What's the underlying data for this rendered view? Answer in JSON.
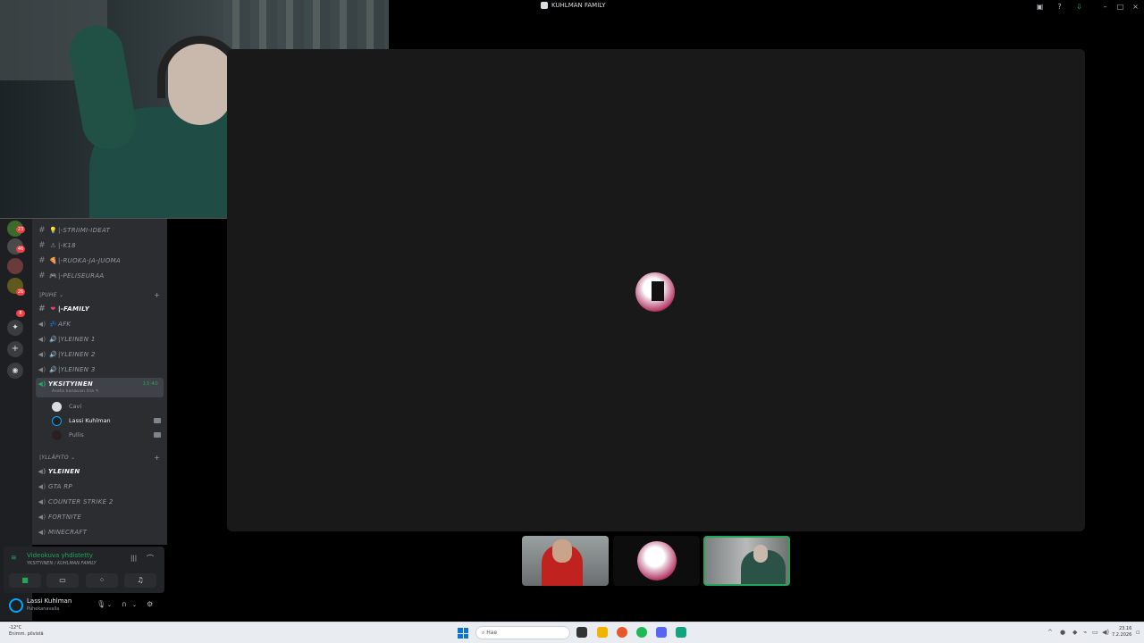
{
  "window": {
    "title": "KUHLMAN FAMILY"
  },
  "server_badges": [
    "23",
    "46",
    "26",
    "8"
  ],
  "sidebar": {
    "text_channels": [
      {
        "emoji": "💡",
        "name": "|-STRIIMI-IDEAT"
      },
      {
        "emoji": "⚠",
        "name": "|-K18"
      },
      {
        "emoji": "🍕",
        "name": "|-RUOKA-JA-JUOMA"
      },
      {
        "emoji": "🎮",
        "name": "|-PELISEURAA"
      }
    ],
    "category_puhe": "|PUHE ⌄",
    "voice_channels": [
      {
        "emoji": "❤",
        "name": "|-FAMILY",
        "bold": true,
        "type": "text"
      },
      {
        "emoji": "💤",
        "name": "AFK"
      },
      {
        "emoji": "🔊",
        "name": "|YLEINEN 1"
      },
      {
        "emoji": "🔊",
        "name": "|YLEINEN 2"
      },
      {
        "emoji": "🔊",
        "name": "|YLEINEN 3"
      }
    ],
    "active_channel": {
      "name": "YKSITYINEN",
      "time": "13:40",
      "subtitle": "Aseta kanavan tila ✎"
    },
    "members": [
      {
        "name": "Cavi",
        "camera": false
      },
      {
        "name": "Lassi Kuhlman",
        "camera": true
      },
      {
        "name": "Pullis",
        "camera": true
      }
    ],
    "category_yllapito": "|YLLÄPITO ⌄",
    "extra_channels": [
      {
        "name": "YLEINEN",
        "bold": true
      },
      {
        "name": "GTA RP"
      },
      {
        "name": "COUNTER STRIKE 2"
      },
      {
        "name": "FORTNITE"
      },
      {
        "name": "MINECRAFT"
      }
    ]
  },
  "voice_panel": {
    "status": "Videokuva yhdistetty",
    "channel": "YKSITYINEN / KUHLMAN FAMILY"
  },
  "user_panel": {
    "name": "Lassi Kuhlman",
    "status": "Puhekanavalla"
  },
  "taskbar": {
    "weather_temp": "-12°C",
    "weather_desc": "Enimm. pilvistä",
    "search_placeholder": "Hae",
    "time": "23.16",
    "date": "7.2.2026"
  },
  "colors": {
    "accent_green": "#23a55a",
    "stage_bg": "#19191a",
    "sidebar_bg": "#2b2d31"
  }
}
